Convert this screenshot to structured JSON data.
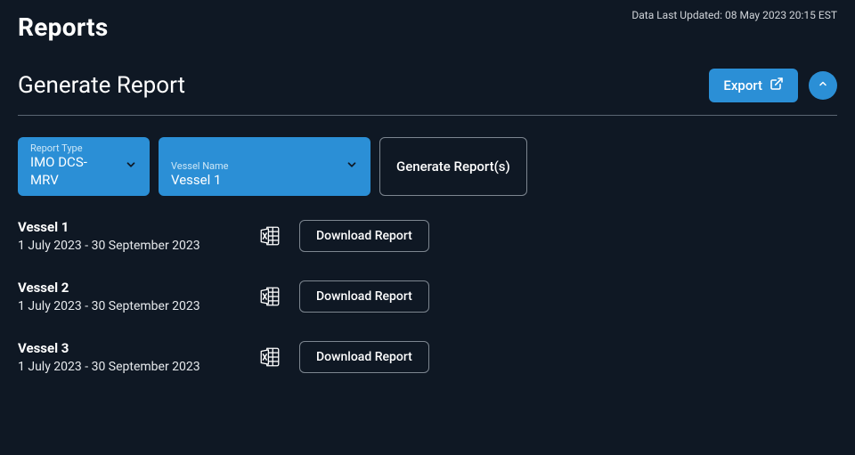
{
  "header": {
    "page_title": "Reports",
    "last_updated": "Data Last Updated: 08 May 2023 20:15 EST"
  },
  "section": {
    "title": "Generate Report",
    "export_label": "Export",
    "generate_label": "Generate Report(s)"
  },
  "filters": {
    "report_type": {
      "label": "Report Type",
      "value": "IMO DCS-MRV"
    },
    "vessel_name": {
      "label": "Vessel Name",
      "value": "Vessel 1"
    }
  },
  "reports": [
    {
      "name": "Vessel 1",
      "period": "1 July 2023 - 30 September 2023",
      "download_label": "Download Report"
    },
    {
      "name": "Vessel 2",
      "period": "1 July 2023 - 30 September 2023",
      "download_label": "Download Report"
    },
    {
      "name": "Vessel 3",
      "period": "1 July 2023 - 30 September 2023",
      "download_label": "Download Report"
    }
  ]
}
